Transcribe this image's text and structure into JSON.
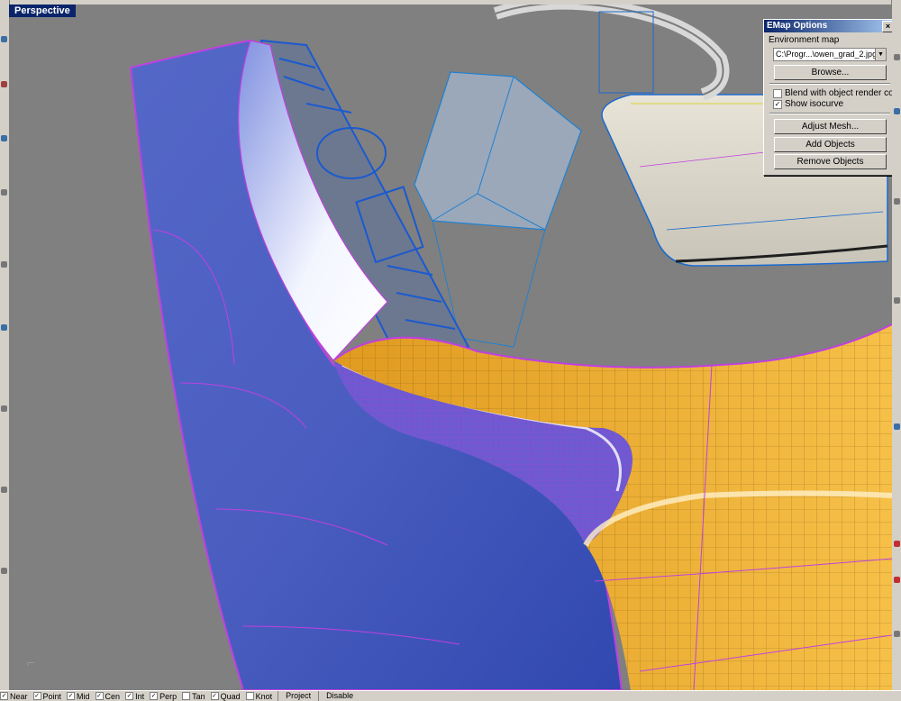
{
  "viewport": {
    "title": "Perspective"
  },
  "emap_dialog": {
    "title": "EMap Options",
    "close_glyph": "×",
    "env_map_label": "Environment map",
    "env_map_value": "C:\\Progr...\\owen_grad_2.jpg",
    "browse_label": "Browse...",
    "blend_label": "Blend with object render color",
    "blend_checked": false,
    "isocurve_label": "Show isocurve",
    "isocurve_checked": true,
    "adjust_mesh_label": "Adjust Mesh...",
    "add_objects_label": "Add Objects",
    "remove_objects_label": "Remove Objects"
  },
  "status_bar": {
    "snaps": [
      {
        "label": "Near",
        "checked": true
      },
      {
        "label": "Point",
        "checked": true
      },
      {
        "label": "Mid",
        "checked": true
      },
      {
        "label": "Cen",
        "checked": true
      },
      {
        "label": "Int",
        "checked": true
      },
      {
        "label": "Perp",
        "checked": true
      },
      {
        "label": "Tan",
        "checked": false
      },
      {
        "label": "Quad",
        "checked": true
      },
      {
        "label": "Knot",
        "checked": false
      }
    ],
    "project_label": "Project",
    "disable_label": "Disable"
  },
  "colors": {
    "viewport_bg": "#808080",
    "blue_surface": "#4a5cc0",
    "orange_surface": "#f0b43c",
    "isocurve": "#c040e0",
    "wire_blue": "#1a6ad0",
    "title_blue": "#0a246a"
  },
  "icons": {
    "axis": "world-axis-icon",
    "close": "close-icon",
    "dropdown": "dropdown-arrow-icon"
  }
}
